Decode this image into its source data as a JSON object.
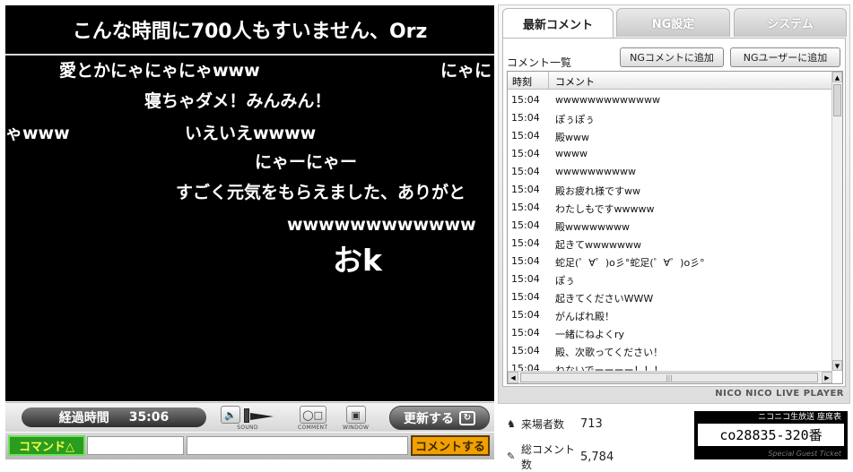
{
  "video": {
    "announcement": "こんな時間に700人もすいません、Orz",
    "comments": [
      "愛とかにゃにゃにゃwww",
      "にゃに",
      "寝ちゃダメ！みんみん！",
      "ゃwww",
      "いえいえwwww",
      "にゃーにゃー",
      "すごく元気をもらえました、ありがと",
      "wwwwwwwwwwww",
      "おk"
    ]
  },
  "controls": {
    "elapsed_label": "経過時間",
    "elapsed_time": "35:06",
    "sound_label": "SOUND",
    "comment_label": "COMMENT",
    "window_label": "WINDOW",
    "update_label": "更新する",
    "command_label": "コマンド△",
    "submit_label": "コメントする",
    "comment_value": ""
  },
  "panel": {
    "tabs": [
      {
        "label": "最新コメント",
        "active": true
      },
      {
        "label": "NG設定",
        "active": false
      },
      {
        "label": "システム",
        "active": false
      }
    ],
    "list_title": "コメント一覧",
    "ng_comment_button": "NGコメントに追加",
    "ng_user_button": "NGユーザーに追加",
    "columns": [
      "時刻",
      "コメント"
    ],
    "rows": [
      {
        "time": "15:04",
        "comment": "wwwwwwwwwwwww"
      },
      {
        "time": "15:04",
        "comment": "ぽぅぽぅ"
      },
      {
        "time": "15:04",
        "comment": "殿www"
      },
      {
        "time": "15:04",
        "comment": "wwww"
      },
      {
        "time": "15:04",
        "comment": "wwwwwwwwww"
      },
      {
        "time": "15:04",
        "comment": "殿お疲れ様ですww"
      },
      {
        "time": "15:04",
        "comment": "わたしもですwwwww"
      },
      {
        "time": "15:04",
        "comment": "殿wwwwwwww"
      },
      {
        "time": "15:04",
        "comment": "起きてwwwwwww"
      },
      {
        "time": "15:04",
        "comment": "蛇足(゜∀゜)o彡°蛇足(゜∀゜)o彡°"
      },
      {
        "time": "15:04",
        "comment": "ぽぅ"
      },
      {
        "time": "15:04",
        "comment": "起きてくださいWWW"
      },
      {
        "time": "15:04",
        "comment": "がんばれ殿！"
      },
      {
        "time": "15:04",
        "comment": "一緒にねよくry"
      },
      {
        "time": "15:04",
        "comment": "殿、次歌ってください！"
      },
      {
        "time": "15:04",
        "comment": "ねないでーーーー！！！"
      }
    ],
    "brand": "NICO NICO LIVE PLAYER"
  },
  "stats": {
    "visitors_label": "来場者数",
    "visitors": "713",
    "comments_label": "総コメント数",
    "comments": "5,784"
  },
  "ticket": {
    "header": "ニコニコ生放送 座席表",
    "seat": "co28835-320番",
    "footer": "Special Guest Ticket"
  }
}
